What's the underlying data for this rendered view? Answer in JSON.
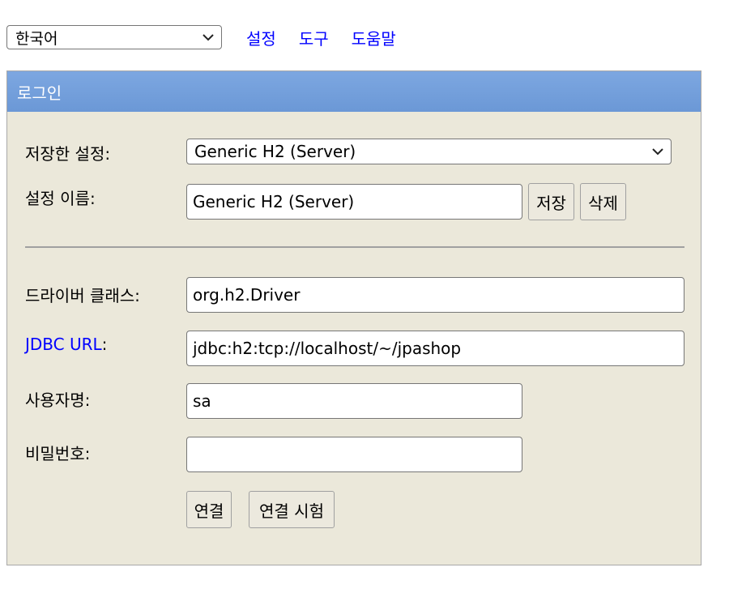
{
  "top_bar": {
    "language": "한국어",
    "links": [
      "설정",
      "도구",
      "도움말"
    ]
  },
  "login": {
    "title": "로그인",
    "saved_settings_label": "저장한 설정:",
    "saved_settings_value": "Generic H2 (Server)",
    "setting_name_label": "설정 이름:",
    "setting_name_value": "Generic H2 (Server)",
    "save_button": "저장",
    "delete_button": "삭제",
    "driver_class_label": "드라이버 클래스:",
    "driver_class_value": "org.h2.Driver",
    "jdbc_url_label": "JDBC URL",
    "jdbc_url_colon": ":",
    "jdbc_url_value": "jdbc:h2:tcp://localhost/~/jpashop",
    "username_label": "사용자명:",
    "username_value": "sa",
    "password_label": "비밀번호:",
    "password_value": "",
    "connect_button": "연결",
    "test_connection_button": "연결 시험"
  },
  "colors": {
    "header_blue": "#6b98d6",
    "panel_bg": "#ebe8da",
    "link_blue": "#0000ff"
  },
  "icons": {
    "dropdown": "chevron-down-icon"
  }
}
